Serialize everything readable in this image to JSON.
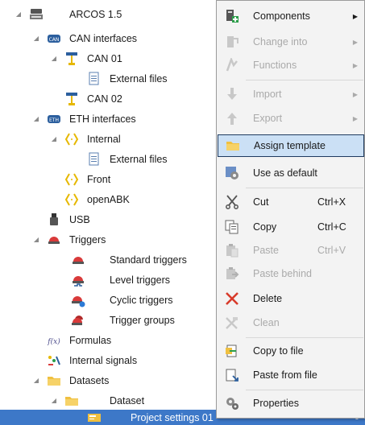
{
  "tree": {
    "rows": [
      {
        "label": "ARCOS 1.5",
        "icon": "project-device-icon"
      },
      {
        "label": "CAN interfaces",
        "icon": "can-bus-icon"
      },
      {
        "label": "CAN 01",
        "icon": "can-channel-icon"
      },
      {
        "label": "External files",
        "icon": "file-icon"
      },
      {
        "label": "CAN 02",
        "icon": "can-channel-icon"
      },
      {
        "label": "ETH interfaces",
        "icon": "ethernet-bus-icon"
      },
      {
        "label": "Internal",
        "icon": "interface-brackets-icon"
      },
      {
        "label": "External files",
        "icon": "file-icon"
      },
      {
        "label": "Front",
        "icon": "interface-brackets-icon"
      },
      {
        "label": "openABK",
        "icon": "interface-brackets-icon"
      },
      {
        "label": "USB",
        "icon": "usb-icon"
      },
      {
        "label": "Triggers",
        "icon": "trigger-icon"
      },
      {
        "label": "Standard triggers",
        "icon": "trigger-icon"
      },
      {
        "label": "Level triggers",
        "icon": "level-trigger-icon"
      },
      {
        "label": "Cyclic triggers",
        "icon": "cyclic-trigger-icon"
      },
      {
        "label": "Trigger groups",
        "icon": "trigger-group-icon"
      },
      {
        "label": "Formulas",
        "icon": "formula-icon"
      },
      {
        "label": "Internal signals",
        "icon": "signal-icon"
      },
      {
        "label": "Datasets",
        "icon": "folder-icon"
      },
      {
        "label": "Dataset",
        "icon": "folder-icon"
      },
      {
        "label": "Project settings 01",
        "icon": "settings-card-icon",
        "trailing": "0"
      }
    ]
  },
  "menu": {
    "items": [
      {
        "label": "Components",
        "icon": "components-icon",
        "submenu": true,
        "disabled": false
      },
      {
        "label": "Change into",
        "icon": "change-into-icon",
        "submenu": true,
        "disabled": true
      },
      {
        "label": "Functions",
        "icon": "functions-icon",
        "submenu": true,
        "disabled": true
      },
      {
        "label": "Import",
        "icon": "import-arrow-icon",
        "submenu": true,
        "disabled": true
      },
      {
        "label": "Export",
        "icon": "export-arrow-icon",
        "submenu": true,
        "disabled": true
      },
      {
        "label": "Assign template",
        "icon": "folder-icon",
        "submenu": false,
        "disabled": false,
        "highlighted": true
      },
      {
        "label": "Use as default",
        "icon": "default-gear-icon",
        "submenu": false,
        "disabled": false
      },
      {
        "label": "Cut",
        "shortcut": "Ctrl+X",
        "icon": "scissors-icon",
        "disabled": false
      },
      {
        "label": "Copy",
        "shortcut": "Ctrl+C",
        "icon": "copy-icon",
        "disabled": false
      },
      {
        "label": "Paste",
        "shortcut": "Ctrl+V",
        "icon": "paste-icon",
        "disabled": true
      },
      {
        "label": "Paste behind",
        "icon": "paste-behind-icon",
        "disabled": true
      },
      {
        "label": "Delete",
        "icon": "delete-x-icon",
        "disabled": false
      },
      {
        "label": "Clean",
        "icon": "clean-icon",
        "disabled": true
      },
      {
        "label": "Copy to file",
        "icon": "copy-to-file-icon",
        "disabled": false
      },
      {
        "label": "Paste from file",
        "icon": "paste-from-file-icon",
        "disabled": false
      },
      {
        "label": "Properties",
        "icon": "properties-gear-icon",
        "disabled": false
      }
    ]
  },
  "colors": {
    "selection": "#3d78c8",
    "menu_highlight": "#cbe0f5",
    "delete_red": "#d83b2b",
    "folder_yellow": "#f0c040"
  }
}
